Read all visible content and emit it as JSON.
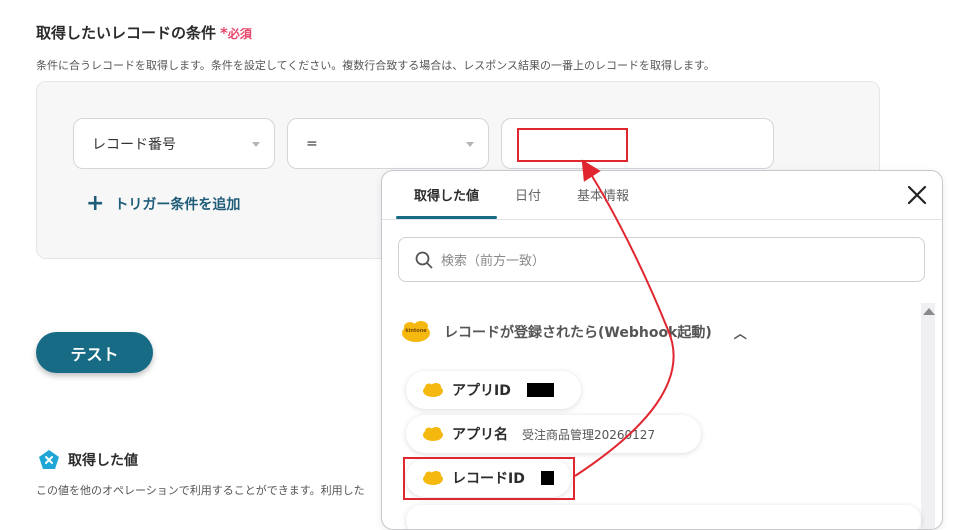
{
  "section": {
    "title": "取得したいレコードの条件",
    "required_star": "*",
    "required_label": "必須",
    "description": "条件に合うレコードを取得します。条件を設定してください。複数行合致する場合は、レスポンス結果の一番上のレコードを取得します。"
  },
  "condition": {
    "field_select": "レコード番号",
    "operator_select": "=",
    "value_input": "",
    "add_condition_icon": "plus-icon",
    "add_condition_label": "トリガー条件を追加"
  },
  "test_button": "テスト",
  "retrieved": {
    "icon": "x-pentagon-icon",
    "title": "取得した値",
    "description": "この値を他のオペレーションで利用することができます。利用した"
  },
  "panel": {
    "tabs": [
      "取得した値",
      "日付",
      "基本情報"
    ],
    "active_tab": 0,
    "close_icon": "close-icon",
    "search_placeholder": "検索（前方一致）",
    "group": {
      "logo_text": "kintone",
      "title": "レコードが登録されたら(Webhook起動)",
      "expanded": true
    },
    "items": [
      {
        "label": "アプリID",
        "value": ""
      },
      {
        "label": "アプリ名",
        "value": "受注商品管理20260127"
      },
      {
        "label": "レコードID",
        "value": ""
      }
    ]
  },
  "colors": {
    "accent": "#176b85",
    "required": "#e8476b",
    "highlight": "#e0262f",
    "kintone_yellow": "#f5b80e"
  }
}
